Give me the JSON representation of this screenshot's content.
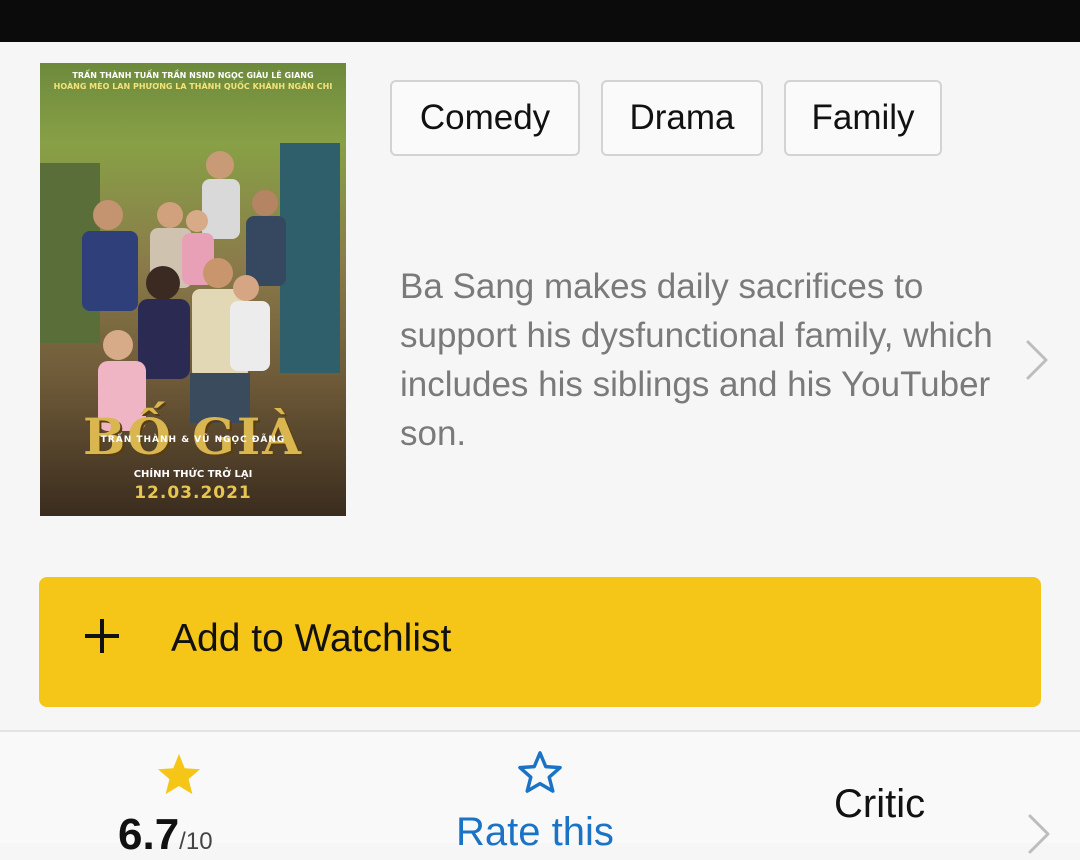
{
  "poster": {
    "credits_line1": "TRẤN THÀNH  TUẤN TRẦN  NSND NGỌC GIÀU  LÊ GIANG",
    "credits_line2": "HOÀNG MÈO  LAN PHƯƠNG  LA THÀNH  QUỐC KHÁNH  NGÂN CHI",
    "directors": "TRẤN THÀNH & VŨ NGỌC ĐÃNG",
    "title": "BỐ GIÀ",
    "tagline": "CHÍNH THỨC TRỞ LẠI",
    "release_date": "12.03.2021"
  },
  "genres": [
    "Comedy",
    "Drama",
    "Family"
  ],
  "plot": "Ba Sang makes daily sacrifices to support his dysfunctional family, which includes his siblings and his YouTuber son.",
  "watchlist": {
    "label": "Add to Watchlist",
    "color": "#f5c518"
  },
  "ratings": {
    "score": "6.7",
    "score_denominator": "/10",
    "rate_label": "Rate this",
    "critic_label": "Critic",
    "star_color": "#f5c518",
    "rate_color": "#1a73c4"
  },
  "icons": [
    "plus-icon",
    "star-filled-icon",
    "star-outline-icon",
    "chevron-right-icon"
  ]
}
